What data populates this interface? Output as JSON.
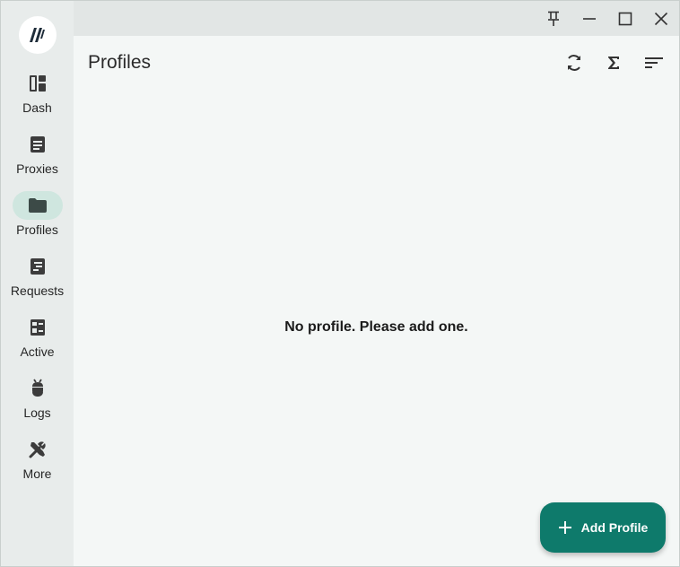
{
  "window": {
    "controls": [
      "pin-icon",
      "minimize-icon",
      "maximize-icon",
      "close-icon"
    ]
  },
  "sidebar": {
    "items": [
      {
        "label": "Dash",
        "icon": "dashboard-icon"
      },
      {
        "label": "Proxies",
        "icon": "document-icon"
      },
      {
        "label": "Profiles",
        "icon": "folder-icon",
        "active": true
      },
      {
        "label": "Requests",
        "icon": "request-icon"
      },
      {
        "label": "Active",
        "icon": "connections-icon"
      },
      {
        "label": "Logs",
        "icon": "bug-icon"
      },
      {
        "label": "More",
        "icon": "tools-icon"
      }
    ]
  },
  "header": {
    "title": "Profiles",
    "actions": [
      "refresh-icon",
      "sigma-icon",
      "sort-icon"
    ]
  },
  "main": {
    "empty_message": "No profile. Please add one."
  },
  "fab": {
    "label": "Add Profile",
    "icon": "plus-icon"
  },
  "colors": {
    "accent": "#0e7a6b",
    "active_pill": "#cfe6df",
    "sidebar_bg": "#e8eceb",
    "content_bg": "#f4f7f6"
  }
}
